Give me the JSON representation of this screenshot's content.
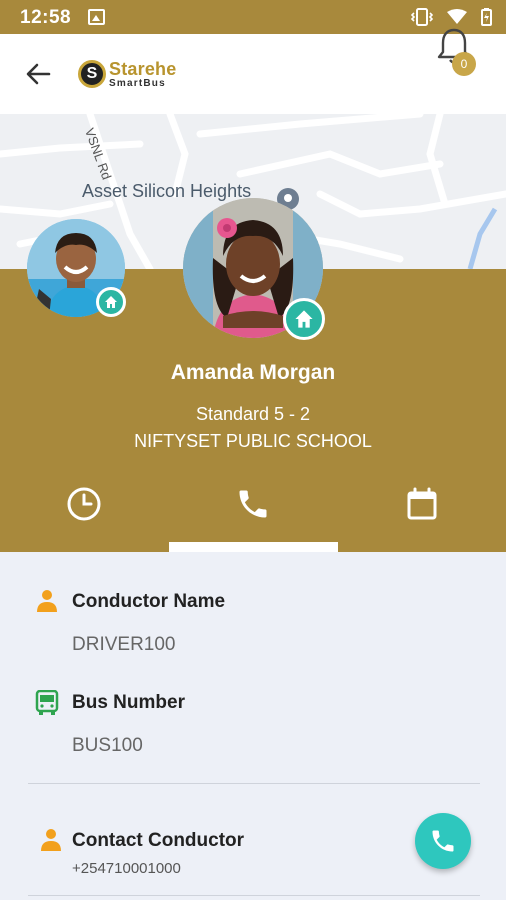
{
  "status_bar": {
    "time": "12:58"
  },
  "header": {
    "logo_letter": "S",
    "logo_main": "Starehe",
    "logo_sub": "SmartBus",
    "notification_count": "0"
  },
  "map": {
    "road_label": "VSNL Rd",
    "place_label": "Asset Silicon Heights"
  },
  "student": {
    "name": "Amanda Morgan",
    "class": "Standard 5 - 2",
    "school": "NIFTYSET PUBLIC SCHOOL"
  },
  "tabs": [
    {
      "icon": "clock-icon"
    },
    {
      "icon": "phone-icon",
      "selected": true
    },
    {
      "icon": "calendar-icon"
    }
  ],
  "contact": {
    "conductor_label": "Conductor Name",
    "conductor_value": "DRIVER100",
    "bus_label": "Bus Number",
    "bus_value": "BUS100",
    "contact_label": "Contact Conductor",
    "contact_phone": "+254710001000"
  },
  "colors": {
    "brand_gold": "#a8893c",
    "accent_teal": "#2ec7be",
    "person_icon": "#f2a01c",
    "bus_icon": "#2ea44f"
  }
}
